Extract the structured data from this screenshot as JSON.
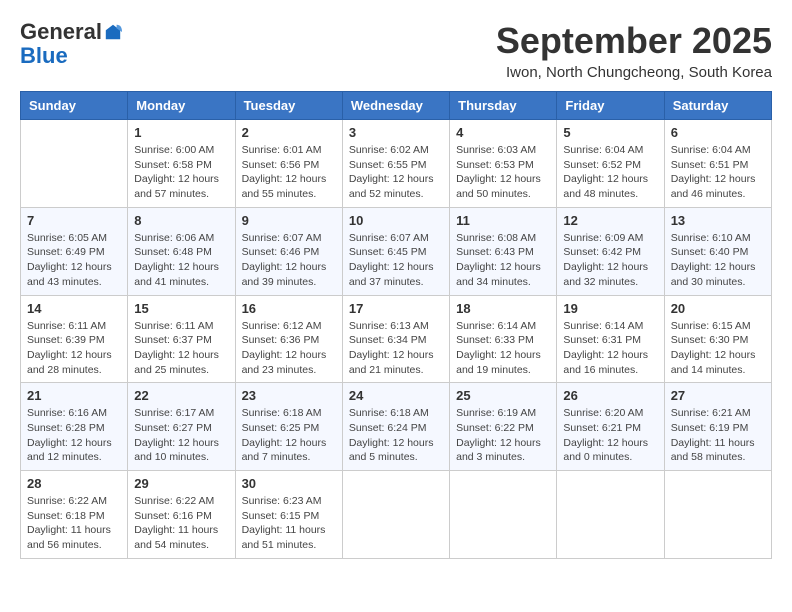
{
  "header": {
    "logo_general": "General",
    "logo_blue": "Blue",
    "month": "September 2025",
    "location": "Iwon, North Chungcheong, South Korea"
  },
  "weekdays": [
    "Sunday",
    "Monday",
    "Tuesday",
    "Wednesday",
    "Thursday",
    "Friday",
    "Saturday"
  ],
  "weeks": [
    [
      {
        "day": "",
        "info": ""
      },
      {
        "day": "1",
        "info": "Sunrise: 6:00 AM\nSunset: 6:58 PM\nDaylight: 12 hours\nand 57 minutes."
      },
      {
        "day": "2",
        "info": "Sunrise: 6:01 AM\nSunset: 6:56 PM\nDaylight: 12 hours\nand 55 minutes."
      },
      {
        "day": "3",
        "info": "Sunrise: 6:02 AM\nSunset: 6:55 PM\nDaylight: 12 hours\nand 52 minutes."
      },
      {
        "day": "4",
        "info": "Sunrise: 6:03 AM\nSunset: 6:53 PM\nDaylight: 12 hours\nand 50 minutes."
      },
      {
        "day": "5",
        "info": "Sunrise: 6:04 AM\nSunset: 6:52 PM\nDaylight: 12 hours\nand 48 minutes."
      },
      {
        "day": "6",
        "info": "Sunrise: 6:04 AM\nSunset: 6:51 PM\nDaylight: 12 hours\nand 46 minutes."
      }
    ],
    [
      {
        "day": "7",
        "info": "Sunrise: 6:05 AM\nSunset: 6:49 PM\nDaylight: 12 hours\nand 43 minutes."
      },
      {
        "day": "8",
        "info": "Sunrise: 6:06 AM\nSunset: 6:48 PM\nDaylight: 12 hours\nand 41 minutes."
      },
      {
        "day": "9",
        "info": "Sunrise: 6:07 AM\nSunset: 6:46 PM\nDaylight: 12 hours\nand 39 minutes."
      },
      {
        "day": "10",
        "info": "Sunrise: 6:07 AM\nSunset: 6:45 PM\nDaylight: 12 hours\nand 37 minutes."
      },
      {
        "day": "11",
        "info": "Sunrise: 6:08 AM\nSunset: 6:43 PM\nDaylight: 12 hours\nand 34 minutes."
      },
      {
        "day": "12",
        "info": "Sunrise: 6:09 AM\nSunset: 6:42 PM\nDaylight: 12 hours\nand 32 minutes."
      },
      {
        "day": "13",
        "info": "Sunrise: 6:10 AM\nSunset: 6:40 PM\nDaylight: 12 hours\nand 30 minutes."
      }
    ],
    [
      {
        "day": "14",
        "info": "Sunrise: 6:11 AM\nSunset: 6:39 PM\nDaylight: 12 hours\nand 28 minutes."
      },
      {
        "day": "15",
        "info": "Sunrise: 6:11 AM\nSunset: 6:37 PM\nDaylight: 12 hours\nand 25 minutes."
      },
      {
        "day": "16",
        "info": "Sunrise: 6:12 AM\nSunset: 6:36 PM\nDaylight: 12 hours\nand 23 minutes."
      },
      {
        "day": "17",
        "info": "Sunrise: 6:13 AM\nSunset: 6:34 PM\nDaylight: 12 hours\nand 21 minutes."
      },
      {
        "day": "18",
        "info": "Sunrise: 6:14 AM\nSunset: 6:33 PM\nDaylight: 12 hours\nand 19 minutes."
      },
      {
        "day": "19",
        "info": "Sunrise: 6:14 AM\nSunset: 6:31 PM\nDaylight: 12 hours\nand 16 minutes."
      },
      {
        "day": "20",
        "info": "Sunrise: 6:15 AM\nSunset: 6:30 PM\nDaylight: 12 hours\nand 14 minutes."
      }
    ],
    [
      {
        "day": "21",
        "info": "Sunrise: 6:16 AM\nSunset: 6:28 PM\nDaylight: 12 hours\nand 12 minutes."
      },
      {
        "day": "22",
        "info": "Sunrise: 6:17 AM\nSunset: 6:27 PM\nDaylight: 12 hours\nand 10 minutes."
      },
      {
        "day": "23",
        "info": "Sunrise: 6:18 AM\nSunset: 6:25 PM\nDaylight: 12 hours\nand 7 minutes."
      },
      {
        "day": "24",
        "info": "Sunrise: 6:18 AM\nSunset: 6:24 PM\nDaylight: 12 hours\nand 5 minutes."
      },
      {
        "day": "25",
        "info": "Sunrise: 6:19 AM\nSunset: 6:22 PM\nDaylight: 12 hours\nand 3 minutes."
      },
      {
        "day": "26",
        "info": "Sunrise: 6:20 AM\nSunset: 6:21 PM\nDaylight: 12 hours\nand 0 minutes."
      },
      {
        "day": "27",
        "info": "Sunrise: 6:21 AM\nSunset: 6:19 PM\nDaylight: 11 hours\nand 58 minutes."
      }
    ],
    [
      {
        "day": "28",
        "info": "Sunrise: 6:22 AM\nSunset: 6:18 PM\nDaylight: 11 hours\nand 56 minutes."
      },
      {
        "day": "29",
        "info": "Sunrise: 6:22 AM\nSunset: 6:16 PM\nDaylight: 11 hours\nand 54 minutes."
      },
      {
        "day": "30",
        "info": "Sunrise: 6:23 AM\nSunset: 6:15 PM\nDaylight: 11 hours\nand 51 minutes."
      },
      {
        "day": "",
        "info": ""
      },
      {
        "day": "",
        "info": ""
      },
      {
        "day": "",
        "info": ""
      },
      {
        "day": "",
        "info": ""
      }
    ]
  ]
}
